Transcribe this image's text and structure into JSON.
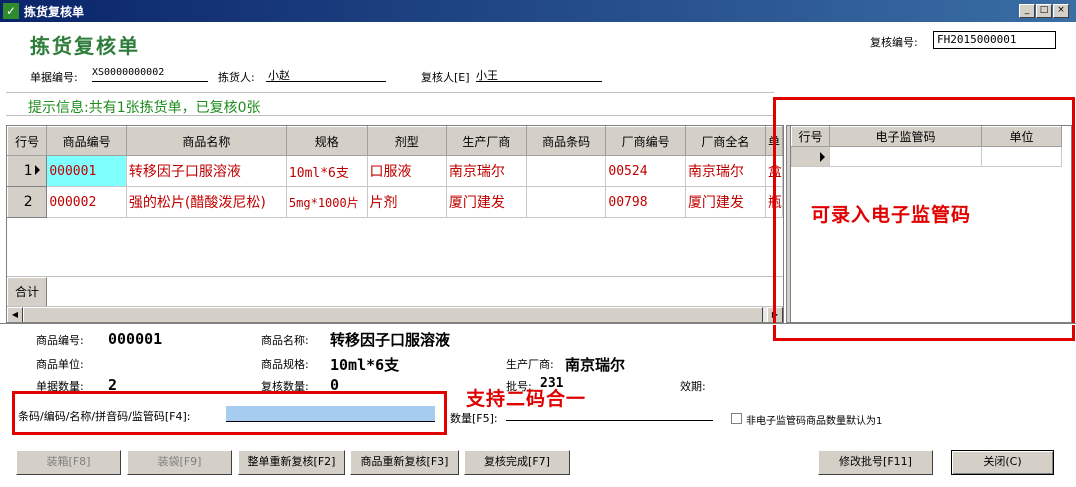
{
  "window": {
    "title": "拣货复核单",
    "controls": [
      "_",
      "□",
      "×"
    ]
  },
  "form": {
    "heading": "拣货复核单",
    "review_no_label": "复核编号:",
    "review_no_value": "FH2015000001",
    "doc_no_label": "单据编号:",
    "doc_no_value": "XS0000000002",
    "picker_label": "拣货人:",
    "picker_value": "小赵",
    "reviewer_label": "复核人[E]",
    "reviewer_value": "小王"
  },
  "hint": "提示信息:共有1张拣货单，已复核0张",
  "main_grid": {
    "columns": [
      "行号",
      "商品编号",
      "商品名称",
      "规格",
      "剂型",
      "生产厂商",
      "商品条码",
      "厂商编号",
      "厂商全名",
      "单"
    ],
    "rows": [
      {
        "no": "1",
        "code": "000001",
        "name": "转移因子口服溶液",
        "spec": "10ml*6支",
        "form": "口服液",
        "maker": "南京瑞尔",
        "barcode": "",
        "maker_code": "00524",
        "maker_full": "南京瑞尔",
        "unit": "盒"
      },
      {
        "no": "2",
        "code": "000002",
        "name": "强的松片(醋酸泼尼松)",
        "spec": "5mg*1000片",
        "form": "片剂",
        "maker": "厦门建发",
        "barcode": "",
        "maker_code": "00798",
        "maker_full": "厦门建发",
        "unit": "瓶"
      }
    ],
    "sum_label": "合计"
  },
  "code_grid": {
    "columns": [
      "行号",
      "电子监管码",
      "单位"
    ]
  },
  "annotations": {
    "code_grid": "可录入电子监管码",
    "scan_input": "支持二码合一"
  },
  "details": {
    "code_label": "商品编号:",
    "code_value": "000001",
    "name_label": "商品名称:",
    "name_value": "转移因子口服溶液",
    "unit_label": "商品单位:",
    "unit_value": "",
    "spec_label": "商品规格:",
    "spec_value": "10ml*6支",
    "maker_label": "生产厂商:",
    "maker_value": "南京瑞尔",
    "doc_qty_label": "单据数量:",
    "doc_qty_value": "2",
    "review_qty_label": "复核数量:",
    "review_qty_value": "0",
    "batch_label": "批号:",
    "batch_value": "231",
    "expiry_label": "效期:",
    "expiry_value": ""
  },
  "scan": {
    "label": "条码/编码/名称/拼音码/监管码[F4]:",
    "value": "",
    "qty_label": "数量[F5]:",
    "qty_value": "",
    "checkbox_label": "非电子监管码商品数量默认为1"
  },
  "buttons": {
    "box": "装箱[F8]",
    "bag": "装袋[F9]",
    "redo_all": "整单重新复核[F2]",
    "redo_item": "商品重新复核[F3]",
    "finish": "复核完成[F7]",
    "edit_batch": "修改批号[F11]",
    "close": "关闭(C)"
  }
}
